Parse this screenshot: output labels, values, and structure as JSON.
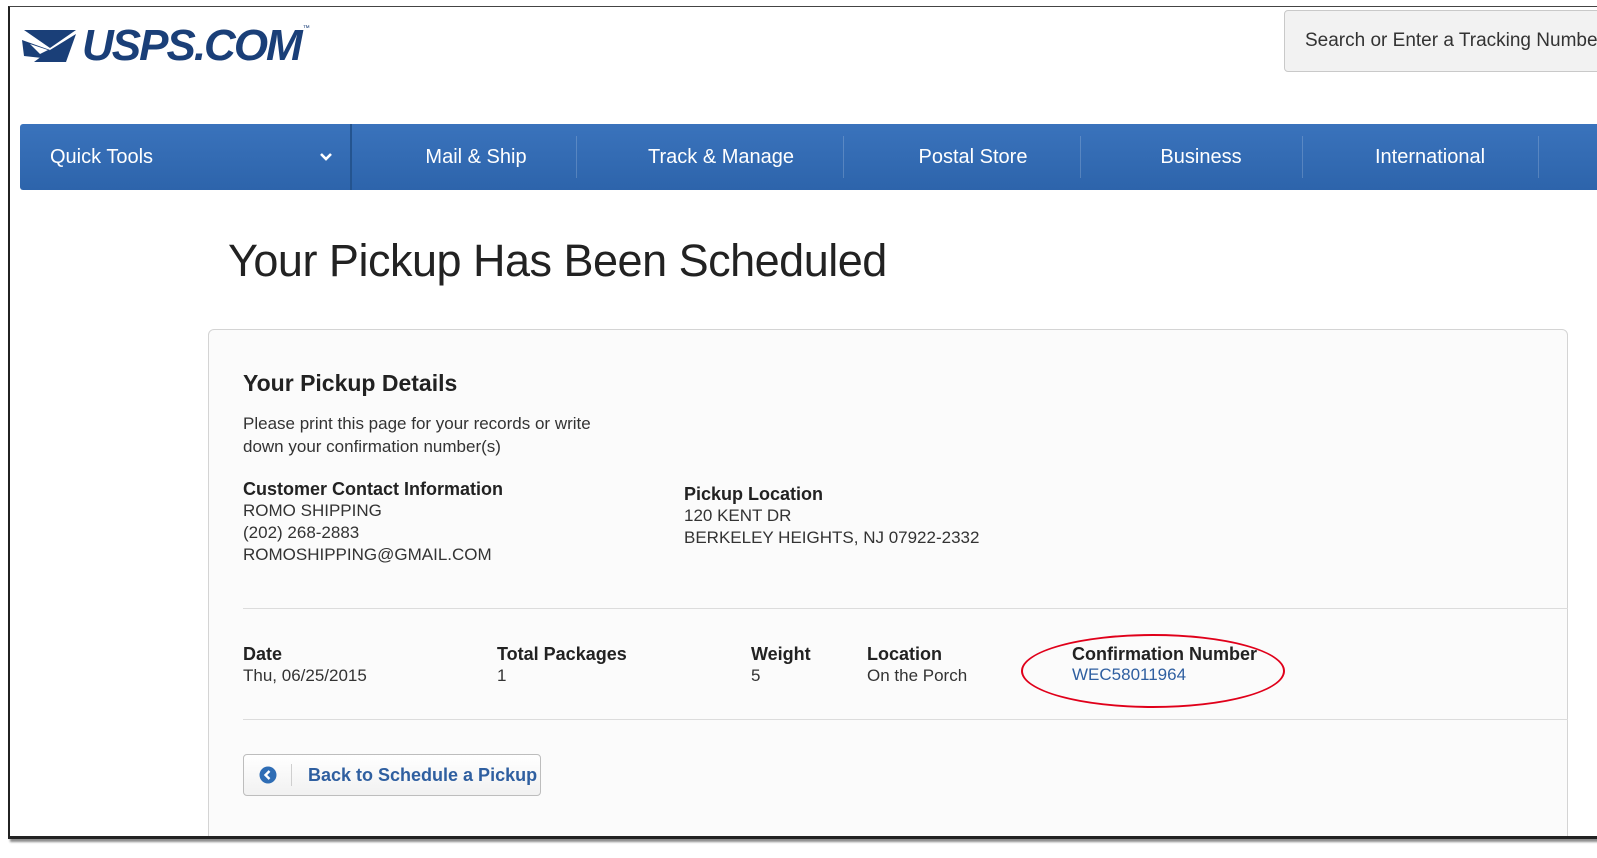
{
  "header": {
    "logo_text": "USPS.COM",
    "logo_tm": "™",
    "search_placeholder": "Search or Enter a Tracking Number"
  },
  "nav": {
    "quick_tools": "Quick Tools",
    "items": [
      "Mail & Ship",
      "Track & Manage",
      "Postal Store",
      "Business",
      "International"
    ]
  },
  "page": {
    "title": "Your Pickup Has Been Scheduled"
  },
  "details": {
    "heading": "Your Pickup Details",
    "intro_line1": "Please print this page for your records or write",
    "intro_line2": "down your confirmation number(s)",
    "contact": {
      "label": "Customer Contact Information",
      "name": "ROMO SHIPPING",
      "phone": "(202) 268-2883",
      "email": "ROMOSHIPPING@GMAIL.COM"
    },
    "pickup_location": {
      "label": "Pickup Location",
      "line1": "120 KENT DR",
      "line2": "BERKELEY HEIGHTS, NJ 07922-2332"
    }
  },
  "summary": {
    "date_label": "Date",
    "date_value": "Thu, 06/25/2015",
    "packages_label": "Total Packages",
    "packages_value": "1",
    "weight_label": "Weight",
    "weight_value": "5",
    "location_label": "Location",
    "location_value": "On the Porch",
    "confirmation_label": "Confirmation Number",
    "confirmation_value": "WEC58011964"
  },
  "actions": {
    "back_label": "Back to Schedule a Pickup"
  },
  "colors": {
    "nav_blue": "#3a73bc",
    "logo_navy": "#1a3f78",
    "link_blue": "#2f5fa0",
    "highlight_red": "#e0001a"
  }
}
